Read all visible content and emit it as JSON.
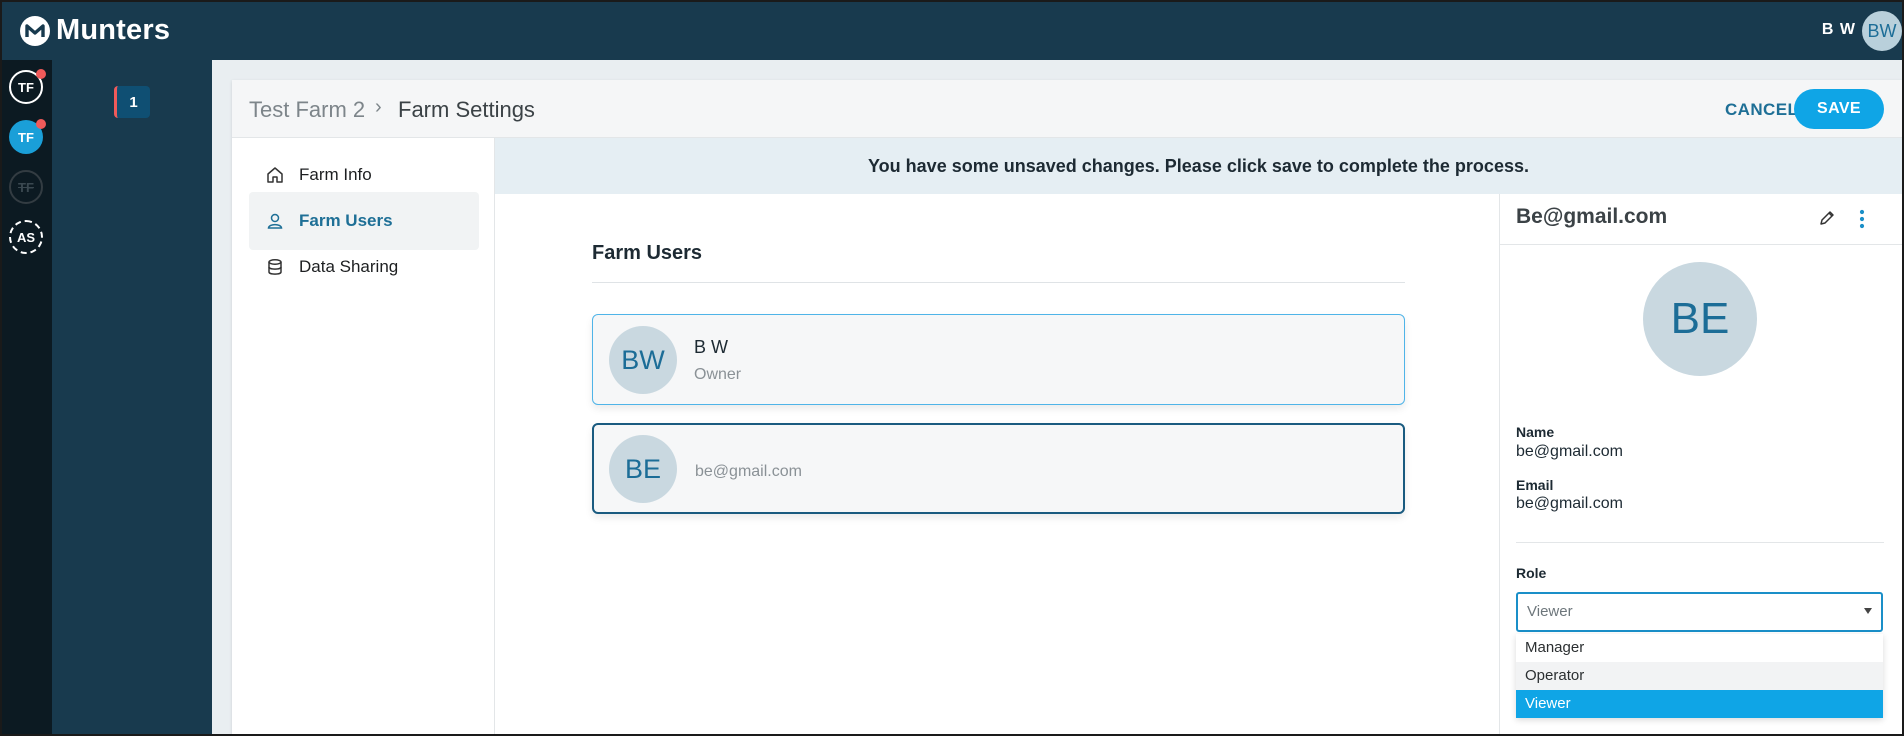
{
  "app": {
    "brand": "Munters",
    "user_initials": "B W",
    "user_avatar": "BW"
  },
  "rail": {
    "farms": [
      "TF",
      "TF",
      "TF",
      "AS"
    ]
  },
  "panel": {
    "badge_count": "1"
  },
  "header": {
    "farm_name": "Test Farm 2",
    "separator": "›",
    "page_title": "Farm Settings",
    "cancel_label": "CANCEL",
    "save_label": "SAVE"
  },
  "nav": {
    "items": [
      {
        "label": "Farm Info",
        "icon": "home-icon"
      },
      {
        "label": "Farm Users",
        "icon": "user-icon"
      },
      {
        "label": "Data Sharing",
        "icon": "database-icon"
      }
    ]
  },
  "banner": {
    "text": "You have some unsaved changes. Please click save to complete the process."
  },
  "users": {
    "title": "Farm Users",
    "list": [
      {
        "initials": "BW",
        "name": "B W",
        "role": "Owner"
      },
      {
        "initials": "BE",
        "email": "be@gmail.com"
      }
    ]
  },
  "detail": {
    "title": "Be@gmail.com",
    "initials": "BE",
    "name_label": "Name",
    "name_value": "be@gmail.com",
    "email_label": "Email",
    "email_value": "be@gmail.com",
    "role_label": "Role",
    "role_value": "Viewer",
    "role_options": [
      "Manager",
      "Operator",
      "Viewer"
    ]
  },
  "colors": {
    "topbar": "#183a4e",
    "accent": "#0fa5e6",
    "link": "#1e6f96",
    "alert": "#f05a5a"
  }
}
